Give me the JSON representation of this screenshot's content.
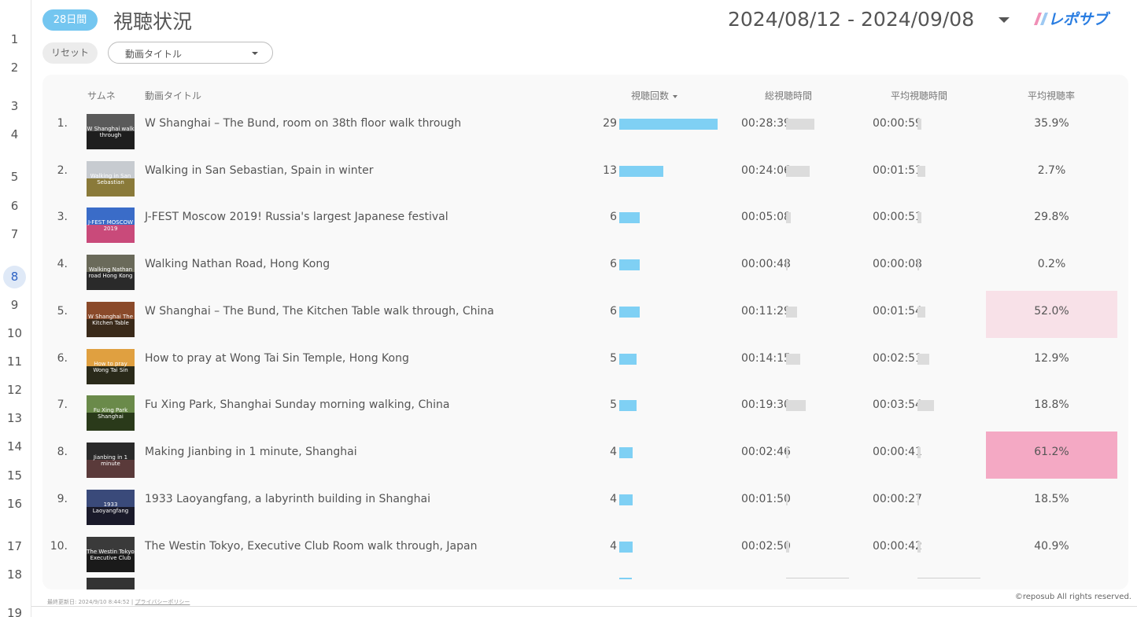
{
  "row_numbers": [
    "1",
    "2",
    "3",
    "4",
    "5",
    "6",
    "7",
    "8",
    "9",
    "10",
    "11",
    "12",
    "13",
    "14",
    "15",
    "16",
    "17",
    "18",
    "19"
  ],
  "selected_row": "8",
  "header": {
    "period_badge": "28日間",
    "title": "視聴状況",
    "date_range": "2024/08/12 - 2024/09/08",
    "logo_text": "レポサブ"
  },
  "filters": {
    "reset_label": "リセット",
    "video_title_dropdown": "動画タイトル"
  },
  "table": {
    "columns": {
      "thumbnail": "サムネ",
      "title": "動画タイトル",
      "views": "視聴回数",
      "total_watch_time": "総視聴時間",
      "avg_watch_time": "平均視聴時間",
      "avg_view_rate": "平均視聴率"
    },
    "rows": [
      {
        "num": "1.",
        "thumb_caption": "W Shanghai walk through",
        "title": "W Shanghai – The Bund, room on 38th floor walk through",
        "views": "29",
        "views_value": 29,
        "total_time": "00:28:39",
        "total_seconds": 1719,
        "avg_time": "00:00:59",
        "avg_seconds": 59,
        "rate": "35.9%",
        "rate_value": 35.9
      },
      {
        "num": "2.",
        "thumb_caption": "Walking in San Sebastian",
        "title": "Walking in San Sebastian, Spain in winter",
        "views": "13",
        "views_value": 13,
        "total_time": "00:24:06",
        "total_seconds": 1446,
        "avg_time": "00:01:51",
        "avg_seconds": 111,
        "rate": "2.7%",
        "rate_value": 2.7
      },
      {
        "num": "3.",
        "thumb_caption": "J-FEST MOSCOW 2019",
        "title": "J-FEST Moscow 2019! Russia's largest Japanese festival",
        "views": "6",
        "views_value": 6,
        "total_time": "00:05:08",
        "total_seconds": 308,
        "avg_time": "00:00:51",
        "avg_seconds": 51,
        "rate": "29.8%",
        "rate_value": 29.8
      },
      {
        "num": "4.",
        "thumb_caption": "Walking Nathan road Hong Kong",
        "title": "Walking Nathan Road, Hong Kong",
        "views": "6",
        "views_value": 6,
        "total_time": "00:00:48",
        "total_seconds": 48,
        "avg_time": "00:00:08",
        "avg_seconds": 8,
        "rate": "0.2%",
        "rate_value": 0.2
      },
      {
        "num": "5.",
        "thumb_caption": "W Shanghai The Kitchen Table",
        "title": "W Shanghai – The Bund, The Kitchen Table walk through, China",
        "views": "6",
        "views_value": 6,
        "total_time": "00:11:29",
        "total_seconds": 689,
        "avg_time": "00:01:54",
        "avg_seconds": 114,
        "rate": "52.0%",
        "rate_value": 52.0
      },
      {
        "num": "6.",
        "thumb_caption": "How to pray Wong Tai Sin",
        "title": "How to pray at Wong Tai Sin Temple, Hong Kong",
        "views": "5",
        "views_value": 5,
        "total_time": "00:14:15",
        "total_seconds": 855,
        "avg_time": "00:02:51",
        "avg_seconds": 171,
        "rate": "12.9%",
        "rate_value": 12.9
      },
      {
        "num": "7.",
        "thumb_caption": "Fu Xing Park Shanghai",
        "title": "Fu Xing Park, Shanghai Sunday morning walking, China",
        "views": "5",
        "views_value": 5,
        "total_time": "00:19:30",
        "total_seconds": 1170,
        "avg_time": "00:03:54",
        "avg_seconds": 234,
        "rate": "18.8%",
        "rate_value": 18.8
      },
      {
        "num": "8.",
        "thumb_caption": "Jianbing in 1 minute",
        "title": "Making Jianbing in 1 minute, Shanghai",
        "views": "4",
        "views_value": 4,
        "total_time": "00:02:46",
        "total_seconds": 166,
        "avg_time": "00:00:41",
        "avg_seconds": 41,
        "rate": "61.2%",
        "rate_value": 61.2
      },
      {
        "num": "9.",
        "thumb_caption": "1933 Laoyangfang",
        "title": "1933 Laoyangfang, a labyrinth building in Shanghai",
        "views": "4",
        "views_value": 4,
        "total_time": "00:01:50",
        "total_seconds": 110,
        "avg_time": "00:00:27",
        "avg_seconds": 27,
        "rate": "18.5%",
        "rate_value": 18.5
      },
      {
        "num": "10.",
        "thumb_caption": "The Westin Tokyo Executive Club",
        "title": "The Westin Tokyo, Executive Club Room walk through, Japan",
        "views": "4",
        "views_value": 4,
        "total_time": "00:02:50",
        "total_seconds": 170,
        "avg_time": "00:00:42",
        "avg_seconds": 42,
        "rate": "40.9%",
        "rate_value": 40.9
      }
    ]
  },
  "footer": {
    "last_updated": "最終更新日: 2024/9/10 8:44:52",
    "separator": "|",
    "privacy_link": "プライバシーポリシー",
    "copyright": "©reposub All rights reserved."
  },
  "colors": {
    "badge": "#74c6f0",
    "views_bar": "#7fd0f4",
    "time_bar": "#dcdcdc",
    "rate_high": "#f4a9c4",
    "rate_mid": "#f8e1e8",
    "logo_blue": "#2a7de1",
    "logo_pink": "#f08fb6"
  },
  "icons": {
    "date_dropdown": "caret-down-icon",
    "sort": "sort-desc-icon",
    "filter_dropdown": "caret-down-icon"
  }
}
